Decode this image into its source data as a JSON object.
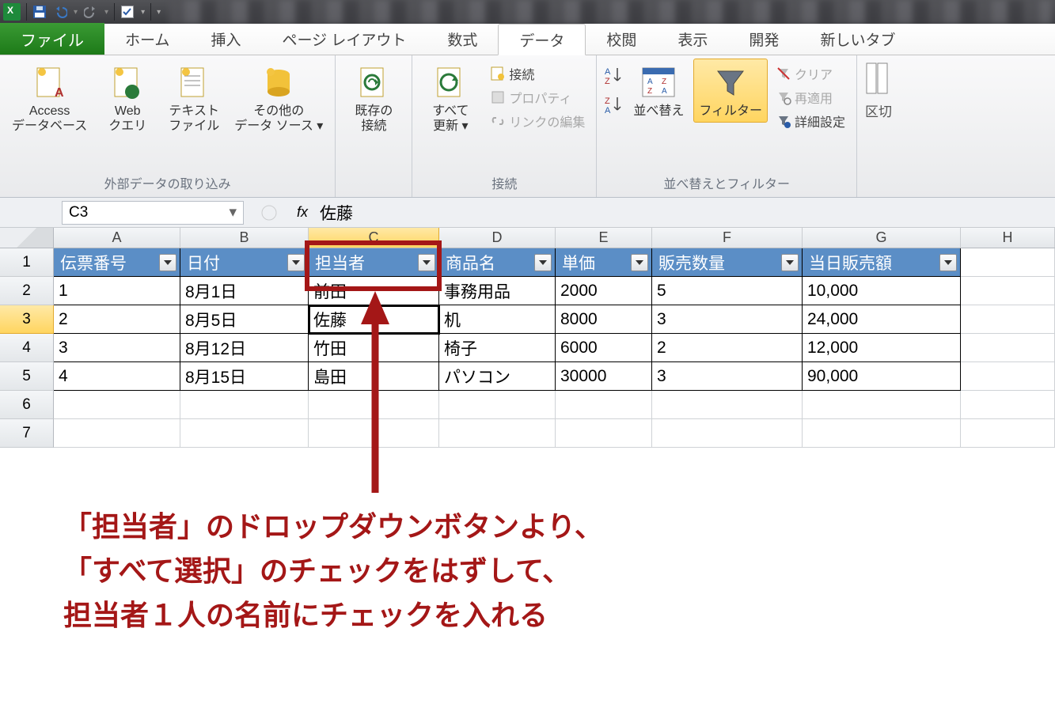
{
  "qat": {
    "save": "save",
    "undo": "undo",
    "redo": "redo",
    "check": "check"
  },
  "tabs": {
    "file": "ファイル",
    "home": "ホーム",
    "insert": "挿入",
    "pagelayout": "ページ レイアウト",
    "formulas": "数式",
    "data": "データ",
    "review": "校閲",
    "view": "表示",
    "dev": "開発",
    "newtab": "新しいタブ"
  },
  "ribbon": {
    "ext": {
      "access": "Access\nデータベース",
      "web": "Web\nクエリ",
      "text": "テキスト\nファイル",
      "other": "その他の\nデータ ソース ▾",
      "group": "外部データの取り込み"
    },
    "existconn": {
      "btn": "既存の\n接続"
    },
    "refresh": {
      "btn": "すべて\n更新 ▾",
      "conn": "接続",
      "prop": "プロパティ",
      "link": "リンクの編集",
      "group": "接続"
    },
    "sort": {
      "sort": "並べ替え",
      "filter": "フィルター",
      "clear": "クリア",
      "reapply": "再適用",
      "adv": "詳細設定",
      "group": "並べ替えとフィルター"
    },
    "right": {
      "split": "区切"
    }
  },
  "namebox": "C3",
  "formula": "佐藤",
  "columns": [
    "A",
    "B",
    "C",
    "D",
    "E",
    "F",
    "G",
    "H"
  ],
  "rows": [
    "1",
    "2",
    "3",
    "4",
    "5",
    "6",
    "7"
  ],
  "headers": {
    "A": "伝票番号",
    "B": "日付",
    "C": "担当者",
    "D": "商品名",
    "E": "単価",
    "F": "販売数量",
    "G": "当日販売額"
  },
  "table": [
    {
      "A": "1",
      "B": "8月1日",
      "C": "前田",
      "D": "事務用品",
      "E": "2000",
      "F": "5",
      "G": "10,000"
    },
    {
      "A": "2",
      "B": "8月5日",
      "C": "佐藤",
      "D": "机",
      "E": "8000",
      "F": "3",
      "G": "24,000"
    },
    {
      "A": "3",
      "B": "8月12日",
      "C": "竹田",
      "D": "椅子",
      "E": "6000",
      "F": "2",
      "G": "12,000"
    },
    {
      "A": "4",
      "B": "8月15日",
      "C": "島田",
      "D": "パソコン",
      "E": "30000",
      "F": "3",
      "G": "90,000"
    }
  ],
  "annotation": {
    "l1": "「担当者」のドロップダウンボタンより、",
    "l2": "「すべて選択」のチェックをはずして、",
    "l3": "担当者１人の名前にチェックを入れる"
  }
}
